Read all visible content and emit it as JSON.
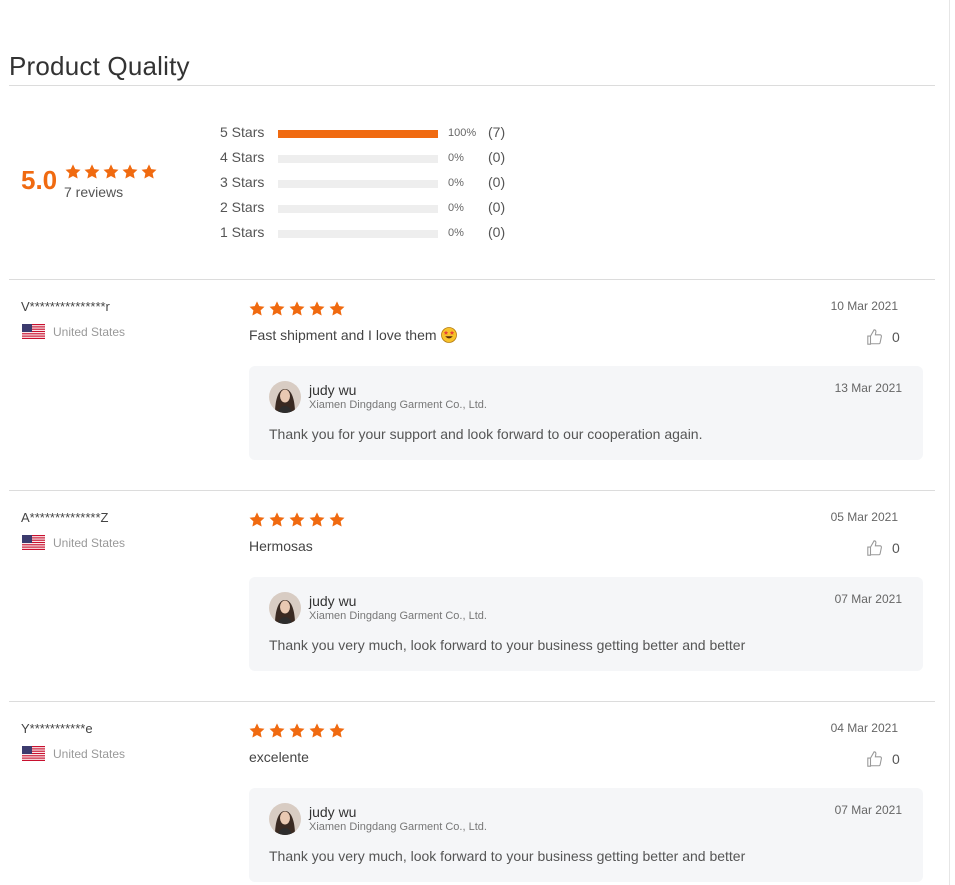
{
  "page": {
    "title": "Product Quality"
  },
  "summary": {
    "average": "5.0",
    "reviews_label": "7 reviews",
    "distribution": [
      {
        "label": "5 Stars",
        "percent": 100,
        "percent_label": "100%",
        "count": "(7)"
      },
      {
        "label": "4 Stars",
        "percent": 0,
        "percent_label": "0%",
        "count": "(0)"
      },
      {
        "label": "3 Stars",
        "percent": 0,
        "percent_label": "0%",
        "count": "(0)"
      },
      {
        "label": "2 Stars",
        "percent": 0,
        "percent_label": "0%",
        "count": "(0)"
      },
      {
        "label": "1 Stars",
        "percent": 0,
        "percent_label": "0%",
        "count": "(0)"
      }
    ]
  },
  "colors": {
    "accent": "#f06a10",
    "reply_bg": "#f5f6f8",
    "divider": "#dcdcdc"
  },
  "reviews": [
    {
      "reviewer": "V***************r",
      "country": "United States",
      "rating": 5,
      "text": "Fast shipment and I love them",
      "emoji": "star-struck-emoji",
      "date": "10 Mar 2021",
      "likes": "0",
      "reply": {
        "name": "judy wu",
        "company": "Xiamen Dingdang Garment Co., Ltd.",
        "date": "13 Mar 2021",
        "text": "Thank you for your support and look forward to our cooperation again."
      }
    },
    {
      "reviewer": "A**************Z",
      "country": "United States",
      "rating": 5,
      "text": "Hermosas",
      "date": "05 Mar 2021",
      "likes": "0",
      "reply": {
        "name": "judy wu",
        "company": "Xiamen Dingdang Garment Co., Ltd.",
        "date": "07 Mar 2021",
        "text": "Thank you very much, look forward to your business getting better and better"
      }
    },
    {
      "reviewer": "Y***********e",
      "country": "United States",
      "rating": 5,
      "text": "excelente",
      "date": "04 Mar 2021",
      "likes": "0",
      "reply": {
        "name": "judy wu",
        "company": "Xiamen Dingdang Garment Co., Ltd.",
        "date": "07 Mar 2021",
        "text": "Thank you very much, look forward to your business getting better and better"
      }
    }
  ]
}
